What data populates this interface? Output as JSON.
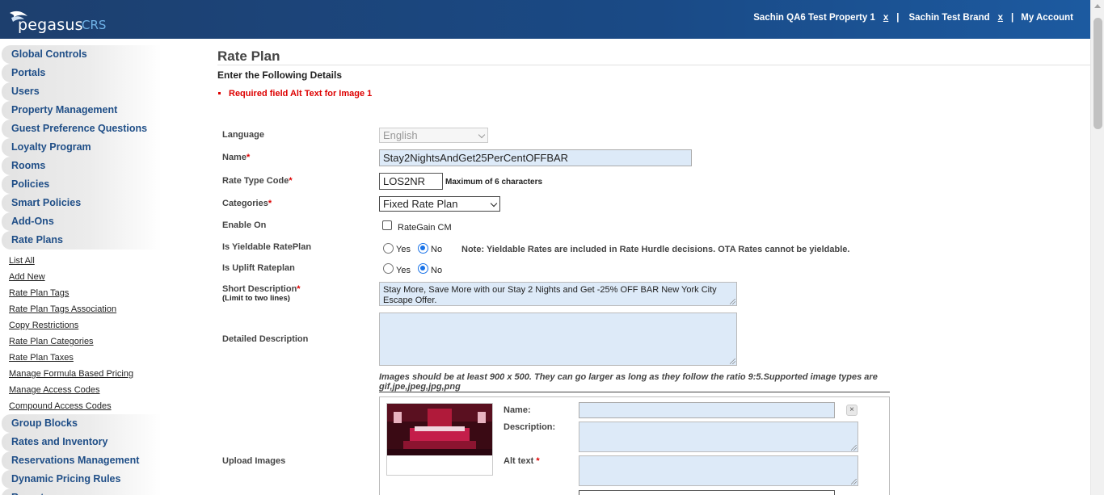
{
  "header": {
    "logo_text": "pegasus",
    "logo_suffix": "CRS",
    "property": "Sachin QA6 Test Property 1",
    "property_close": "x",
    "brand": "Sachin Test Brand",
    "brand_close": "x",
    "separator": "|",
    "account": "My Account"
  },
  "sidebar": {
    "items_top": [
      "Global Controls",
      "Portals",
      "Users",
      "Property Management",
      "Guest Preference Questions",
      "Loyalty Program",
      "Rooms",
      "Policies",
      "Smart Policies",
      "Add-Ons",
      "Rate Plans"
    ],
    "sub_items": [
      "List All",
      "Add New",
      "Rate Plan Tags",
      "Rate Plan Tags Association",
      "Copy Restrictions",
      "Rate Plan Categories",
      "Rate Plan Taxes",
      "Manage Formula Based Pricing",
      "Manage Access Codes",
      "Compound Access Codes"
    ],
    "items_bottom": [
      "Group Blocks",
      "Rates and Inventory",
      "Reservations Management",
      "Dynamic Pricing Rules",
      "Reports"
    ]
  },
  "page": {
    "title": "Rate Plan",
    "subtitle": "Enter the Following Details",
    "error": "Required field Alt Text for Image 1"
  },
  "form": {
    "language_label": "Language",
    "language_value": "English",
    "name_label": "Name",
    "name_value": "Stay2NightsAndGet25PerCentOFFBAR",
    "ratecode_label": "Rate Type Code",
    "ratecode_value": "LOS2NR",
    "ratecode_hint": "Maximum of 6 characters",
    "categories_label": "Categories",
    "categories_value": "Fixed Rate Plan",
    "enable_label": "Enable On",
    "enable_option": "RateGain CM",
    "yieldable_label": "Is Yieldable RatePlan",
    "yes": "Yes",
    "no": "No",
    "yieldable_note": "Note: Yieldable Rates are included in Rate Hurdle decisions. OTA Rates cannot be yieldable.",
    "uplift_label": "Is Uplift Rateplan",
    "short_desc_label": "Short Description",
    "short_desc_hint": "(Limit to two lines)",
    "short_desc_value": "Stay More, Save More with our Stay 2 Nights and Get -25% OFF BAR New York City Escape Offer.",
    "detailed_desc_label": "Detailed Description",
    "detailed_desc_value": "",
    "required_mark": "*"
  },
  "images": {
    "note": "Images should be at least 900 x 500. They can go larger as long as they follow the ratio 9:5.Supported image types are gif,jpe,jpeg,jpg,png",
    "upload_label": "Upload Images",
    "name_label": "Name:",
    "description_label": "Description:",
    "alt_label": "Alt text",
    "close": "×"
  }
}
